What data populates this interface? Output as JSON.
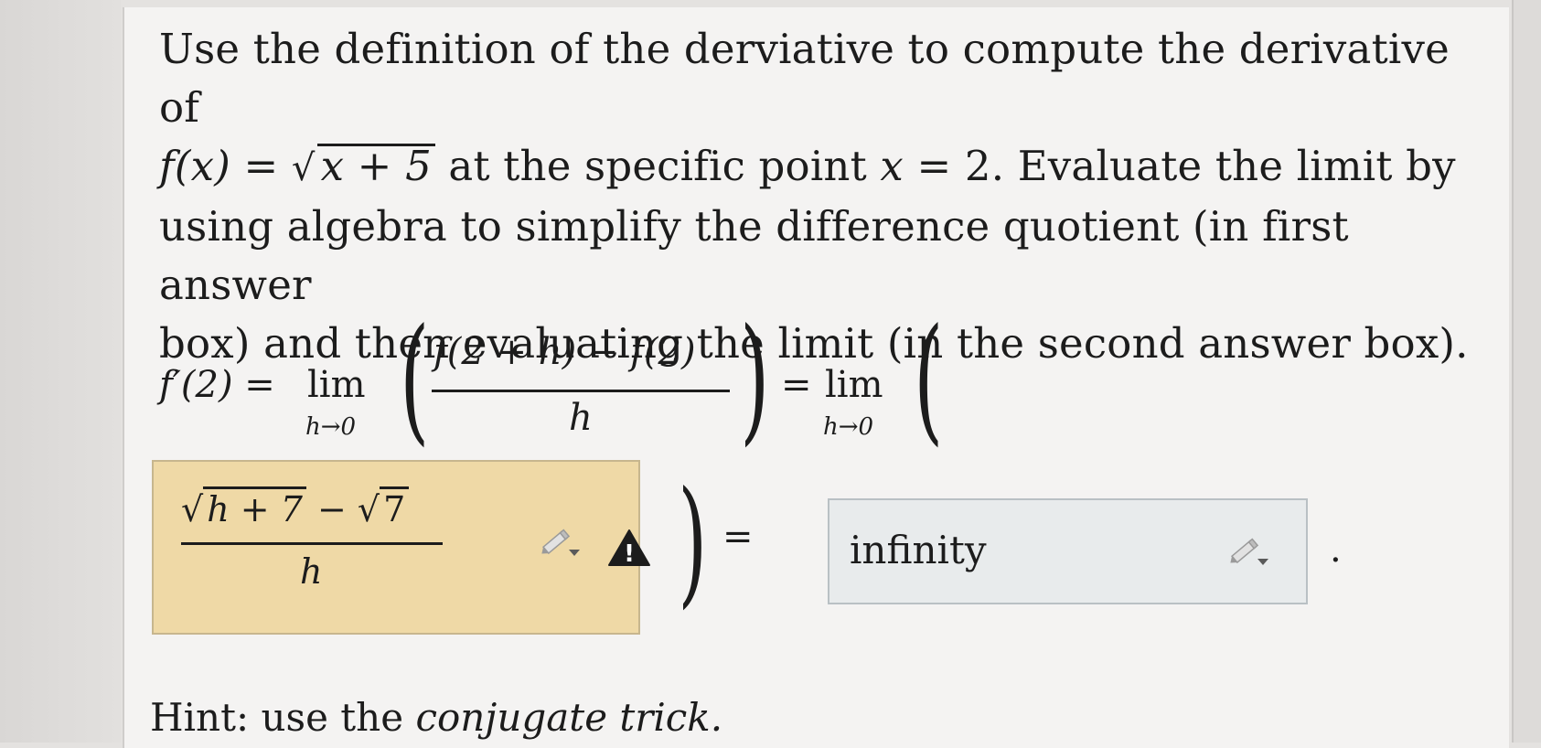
{
  "question": {
    "line1": "Use the definition of the derviative to compute the derivative of",
    "line2_func": "f(x) =",
    "line2_sqrt": "x + 5",
    "line2_rest": "at the specific point",
    "line2_var": "x",
    "line2_eq": "= 2. Evaluate the limit by",
    "line3": "using algebra to simplify the difference quotient (in first answer",
    "line4": "box) and then evaluating the limit (in the second answer box)."
  },
  "equation": {
    "lhs": "f′(2) =",
    "lim": "lim",
    "lim_sub": "h→0",
    "numerator": "f(2 + h) − f(2)",
    "denominator": "h",
    "equals": "=",
    "equals2": "=",
    "period": "."
  },
  "answer1": {
    "sqrt_a": "h + 7",
    "minus": "−",
    "sqrt_b": "7",
    "denominator": "h",
    "warning_glyph": "!"
  },
  "answer2": {
    "value": "infinity"
  },
  "hint": {
    "prefix": "Hint: use the",
    "emph": "conjugate trick."
  },
  "colors": {
    "answer1_bg": "#efd9a6",
    "answer2_bg": "#e8ebec",
    "warning": "#1c1c1c"
  },
  "icons": [
    "pencil-dropdown-icon",
    "warning-icon"
  ]
}
